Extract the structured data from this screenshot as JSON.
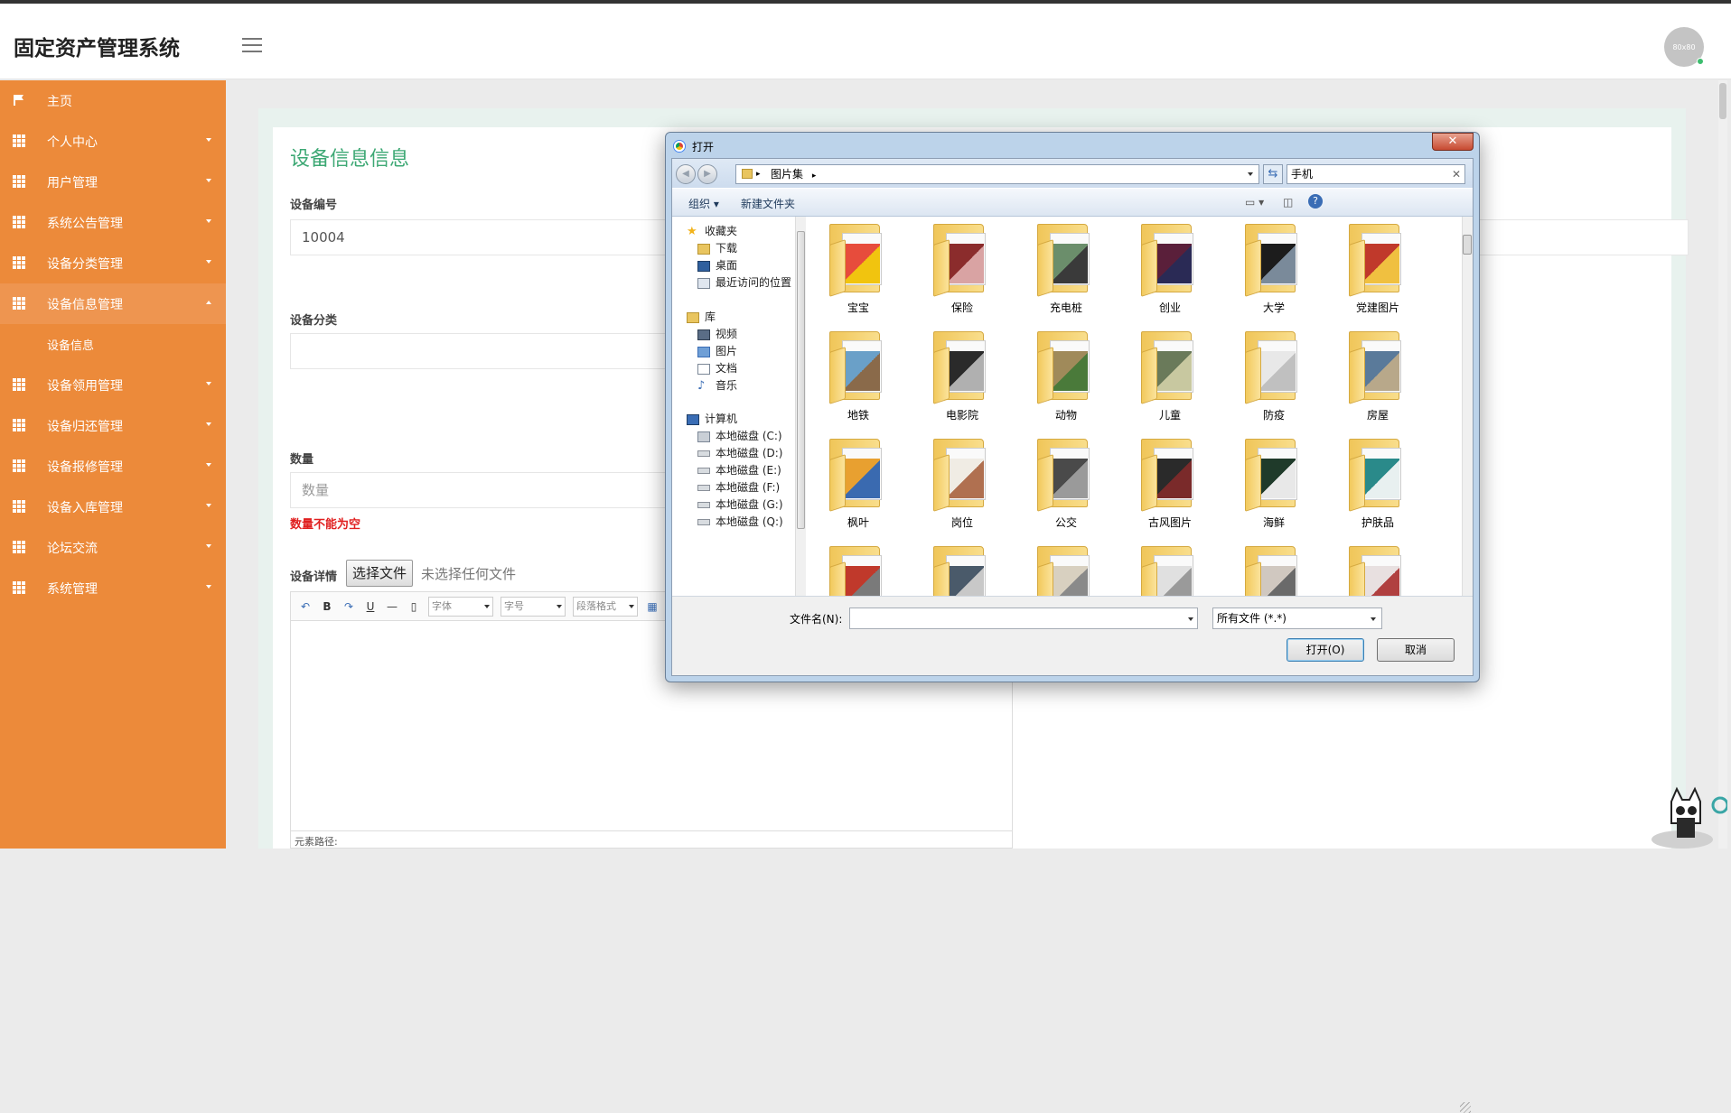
{
  "app": {
    "title": "固定资产管理系统",
    "avatar_text": "80x80"
  },
  "sidebar": {
    "items": [
      {
        "label": "主页",
        "icon": "flag-icon",
        "has_arrow": false
      },
      {
        "label": "个人中心",
        "icon": "grid-icon",
        "has_arrow": true
      },
      {
        "label": "用户管理",
        "icon": "grid-icon",
        "has_arrow": true
      },
      {
        "label": "系统公告管理",
        "icon": "grid-icon",
        "has_arrow": true
      },
      {
        "label": "设备分类管理",
        "icon": "grid-icon",
        "has_arrow": true
      },
      {
        "label": "设备信息管理",
        "icon": "grid-icon",
        "has_arrow": true,
        "expanded": true
      },
      {
        "label": "设备领用管理",
        "icon": "grid-icon",
        "has_arrow": true
      },
      {
        "label": "设备归还管理",
        "icon": "grid-icon",
        "has_arrow": true
      },
      {
        "label": "设备报修管理",
        "icon": "grid-icon",
        "has_arrow": true
      },
      {
        "label": "设备入库管理",
        "icon": "grid-icon",
        "has_arrow": true
      },
      {
        "label": "论坛交流",
        "icon": "grid-icon",
        "has_arrow": true
      },
      {
        "label": "系统管理",
        "icon": "grid-icon",
        "has_arrow": true
      }
    ],
    "subitem": "设备信息"
  },
  "form": {
    "page_title": "设备信息信息",
    "field_code_label": "设备编号",
    "field_code_value": "10004",
    "field_category_label": "设备分类",
    "field_qty_label": "数量",
    "field_qty_placeholder": "数量",
    "qty_error": "数量不能为空",
    "detail_label": "设备详情",
    "file_button": "选择文件",
    "file_none": "未选择任何文件",
    "editor_font": "字体",
    "editor_size": "字号",
    "editor_paragraph": "段落格式",
    "editor_path": "元素路径:"
  },
  "dialog": {
    "title": "打开",
    "close": "✕",
    "breadcrumb": "图片集",
    "search_value": "手机",
    "organize": "组织",
    "new_folder": "新建文件夹",
    "nav_favorites": "收藏夹",
    "nav_favorites_items": [
      "下载",
      "桌面",
      "最近访问的位置"
    ],
    "nav_library": "库",
    "nav_library_items": [
      "视频",
      "图片",
      "文档",
      "音乐"
    ],
    "nav_computer": "计算机",
    "nav_drives": [
      "本地磁盘 (C:)",
      "本地磁盘 (D:)",
      "本地磁盘 (E:)",
      "本地磁盘 (F:)",
      "本地磁盘 (G:)",
      "本地磁盘 (Q:)"
    ],
    "folders": [
      "宝宝",
      "保险",
      "充电桩",
      "创业",
      "大学",
      "党建图片",
      "地铁",
      "电影院",
      "动物",
      "儿童",
      "防疫",
      "房屋",
      "枫叶",
      "岗位",
      "公交",
      "古风图片",
      "海鲜",
      "护肤品",
      "",
      "",
      "",
      "",
      "",
      ""
    ],
    "filename_label": "文件名(N):",
    "filename_value": "",
    "filetype": "所有文件 (*.*)",
    "open_button": "打开(O)",
    "cancel_button": "取消"
  }
}
